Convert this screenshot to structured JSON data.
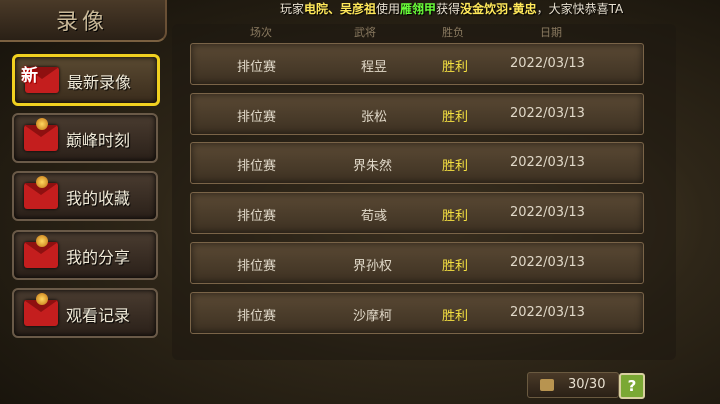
{
  "page_title": "录像",
  "ticker": {
    "p1": "玩家",
    "player": "电院、吴彦祖",
    "p2": "使用",
    "item": "雁翎甲",
    "p3": "获得",
    "reward": "没金饮羽·黄忠",
    "p4": "，大家快恭喜TA"
  },
  "sidebar": {
    "new_badge": "新",
    "items": [
      {
        "label": "最新录像",
        "active": true
      },
      {
        "label": "巅峰时刻",
        "active": false
      },
      {
        "label": "我的收藏",
        "active": false
      },
      {
        "label": "我的分享",
        "active": false
      },
      {
        "label": "观看记录",
        "active": false
      }
    ]
  },
  "table": {
    "headers": [
      "场次",
      "武将",
      "胜负",
      "日期"
    ],
    "rows": [
      {
        "mode": "排位赛",
        "general": "程昱",
        "result": "胜利",
        "date": "2022/03/13"
      },
      {
        "mode": "排位赛",
        "general": "张松",
        "result": "胜利",
        "date": "2022/03/13"
      },
      {
        "mode": "排位赛",
        "general": "界朱然",
        "result": "胜利",
        "date": "2022/03/13"
      },
      {
        "mode": "排位赛",
        "general": "荀彧",
        "result": "胜利",
        "date": "2022/03/13"
      },
      {
        "mode": "排位赛",
        "general": "界孙权",
        "result": "胜利",
        "date": "2022/03/13"
      },
      {
        "mode": "排位赛",
        "general": "沙摩柯",
        "result": "胜利",
        "date": "2022/03/13"
      }
    ]
  },
  "footer": {
    "count": "30/30",
    "help": "?"
  },
  "colors": {
    "active_border": "#f0d020",
    "win_text": "#f4e040",
    "ticker_highlight": "#ffe85a",
    "ticker_item": "#6aff3a"
  }
}
